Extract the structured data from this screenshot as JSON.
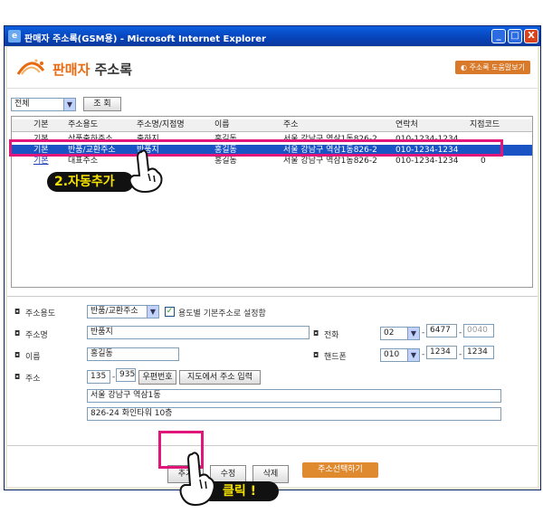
{
  "window": {
    "title": "판매자 주소록(GSM용) - Microsoft Internet Explorer",
    "minimize": "_",
    "maximize": "□",
    "close": "X"
  },
  "header": {
    "title_orange": "판매자",
    "title_rest": " 주소록",
    "help_button": "주소록 도움말보기"
  },
  "filter": {
    "selected": "전체",
    "search_button": "조 회"
  },
  "list": {
    "columns": [
      "기본",
      "주소용도",
      "주소명/지점명",
      "이름",
      "주소",
      "연락처",
      "지점코드"
    ],
    "rows": [
      [
        "기본",
        "상품출하주소",
        "출하지",
        "홍길동",
        "서울 강남구 역삼1동826-2",
        "010-1234-1234",
        ""
      ],
      [
        "기본",
        "반품/교환주소",
        "반품지",
        "홍길동",
        "서울 강남구 역삼1동826-2",
        "010-1234-1234",
        ""
      ],
      [
        "기본",
        "대표주소",
        "",
        "홍길동",
        "서울 강남구 역삼1동826-2",
        "010-1234-1234",
        "0"
      ]
    ]
  },
  "callouts": {
    "auto_add": "2.자동추가",
    "click": "클릭 !"
  },
  "form": {
    "purpose_label": "주소용도",
    "purpose_value": "반품/교환주소",
    "default_checkbox_label": "용도별 기본주소로 설정함",
    "name_label": "주소명",
    "name_value": "반품지",
    "person_label": "이름",
    "person_value": "홍길동",
    "address_label": "주소",
    "zip1": "135",
    "zip2": "935",
    "zip_button": "우편번호",
    "map_button": "지도에서 주소 입력",
    "address1": "서울 강남구 역삼1동",
    "address2": "826-24  화인타워 10층",
    "phone_label": "전화",
    "phone1": "02",
    "phone2": "6477",
    "phone3": "0040",
    "mobile_label": "핸드폰",
    "mobile1": "010",
    "mobile2": "1234",
    "mobile3": "1234"
  },
  "actions": {
    "add": "추가",
    "edit": "수정",
    "delete": "삭제",
    "select_address": "주소선택하기"
  },
  "colors": {
    "accent_orange": "#e86a10",
    "highlight_pink": "#e0167a",
    "selection_blue": "#1a53c4",
    "callout_yellow": "#f6e300"
  }
}
